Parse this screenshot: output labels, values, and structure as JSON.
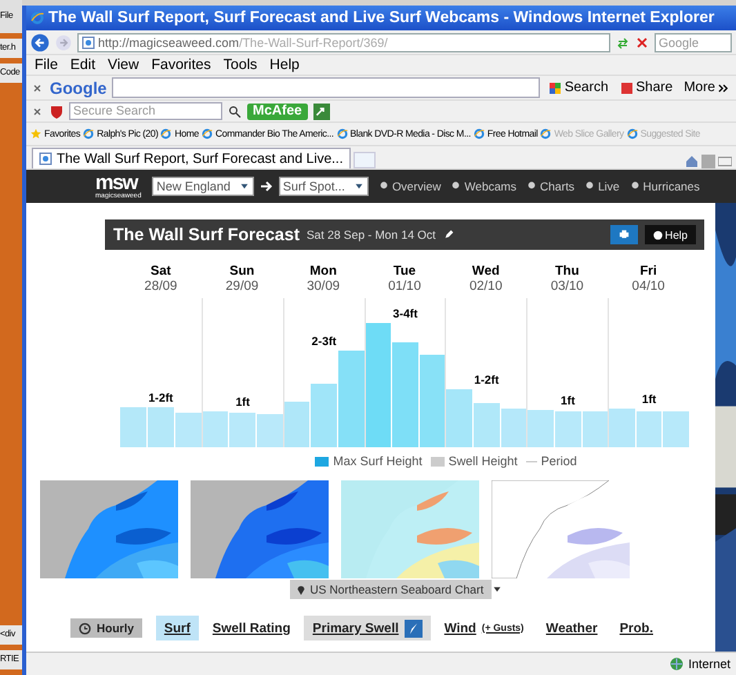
{
  "background_window": {
    "texts": [
      "File",
      "ter.h",
      "Code",
      "<div",
      "RTIE"
    ]
  },
  "window": {
    "title": "The Wall Surf Report, Surf Forecast and Live Surf Webcams - Windows Internet Explorer"
  },
  "address_bar": {
    "url_host": "http://magicseaweed.com",
    "url_path": "/The-Wall-Surf-Report/369/",
    "search_placeholder": "Google"
  },
  "menu": [
    "File",
    "Edit",
    "View",
    "Favorites",
    "Tools",
    "Help"
  ],
  "google_toolbar": {
    "logo": "Google",
    "buttons": [
      "Search",
      "Share",
      "More"
    ]
  },
  "mcafee_toolbar": {
    "placeholder": "Secure Search",
    "badge": "McAfee"
  },
  "favorites_bar": {
    "label": "Favorites",
    "items": [
      {
        "label": "Ralph's Pic (20)",
        "disabled": false
      },
      {
        "label": "Home",
        "disabled": false
      },
      {
        "label": "Commander Bio  The Americ...",
        "disabled": false
      },
      {
        "label": "Blank DVD-R Media - Disc M...",
        "disabled": false
      },
      {
        "label": "Free Hotmail",
        "disabled": false
      },
      {
        "label": "Web Slice Gallery",
        "disabled": true
      },
      {
        "label": "Suggested Site",
        "disabled": true
      }
    ]
  },
  "tabs": [
    {
      "label": "The Wall Surf Report, Surf Forecast and Live...",
      "selected": true
    }
  ],
  "site_nav": {
    "logo": "msw",
    "logo_sub": "magicseaweed",
    "region": "New England",
    "spot": "Surf Spot...",
    "links": [
      "Overview",
      "Webcams",
      "Charts",
      "Live",
      "Hurricanes"
    ]
  },
  "forecast": {
    "title": "The Wall Surf Forecast",
    "range": "Sat 28 Sep - Mon 14 Oct",
    "help": "Help",
    "days": [
      {
        "day": "Sat",
        "date": "28/09",
        "surf": "1-2ft"
      },
      {
        "day": "Sun",
        "date": "29/09",
        "surf": "1ft"
      },
      {
        "day": "Mon",
        "date": "30/09",
        "surf": "2-3ft"
      },
      {
        "day": "Tue",
        "date": "01/10",
        "surf": "3-4ft"
      },
      {
        "day": "Wed",
        "date": "02/10",
        "surf": "1-2ft"
      },
      {
        "day": "Thu",
        "date": "03/10",
        "surf": "1ft"
      },
      {
        "day": "Fri",
        "date": "04/10",
        "surf": "1ft"
      }
    ],
    "legend": [
      {
        "label": "Max Surf Height",
        "kind": "swatch",
        "color": "#1ea7e1"
      },
      {
        "label": "Swell Height",
        "kind": "swatch",
        "color": "#cccccc"
      },
      {
        "label": "Period",
        "kind": "line",
        "color": "#cccccc"
      }
    ]
  },
  "chart_selector": "US Northeastern Seaboard Chart",
  "table_tabs": [
    {
      "label": "Hourly",
      "kind": "button",
      "selected": false
    },
    {
      "label": "Surf",
      "kind": "tab",
      "selected": true
    },
    {
      "label": "Swell Rating",
      "kind": "tab",
      "selected": false
    },
    {
      "label": "Primary Swell",
      "kind": "swell",
      "selected": false
    },
    {
      "label": "Wind",
      "note": "(+ Gusts)",
      "kind": "tab",
      "selected": false
    },
    {
      "label": "Weather",
      "kind": "tab",
      "selected": false
    },
    {
      "label": "Prob.",
      "kind": "tab",
      "selected": false
    }
  ],
  "status_bar": {
    "zone": "Internet"
  }
}
